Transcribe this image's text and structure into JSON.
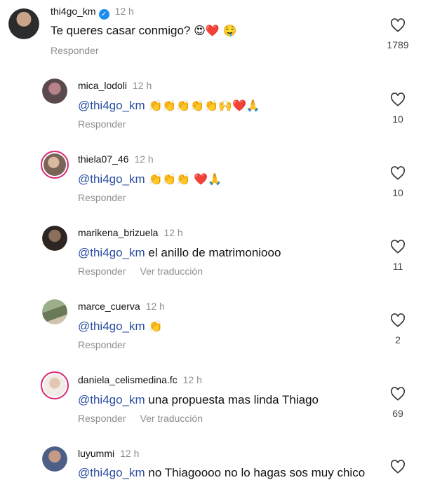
{
  "comments": [
    {
      "username": "thi4go_km",
      "time": "12 h",
      "verified": true,
      "mention": "",
      "text": "Te queres casar conmigo? ",
      "emoji": "😍❤️ 🤤",
      "reply": "Responder",
      "translate": "",
      "likes": "1789"
    },
    {
      "username": "mica_lodoli",
      "time": "12 h",
      "mention": "@thi4go_km",
      "text": "",
      "emoji": "👏👏👏👏👏🙌❤️🙏",
      "reply": "Responder",
      "translate": "",
      "likes": "10"
    },
    {
      "username": "thiela07_46",
      "time": "12 h",
      "mention": "@thi4go_km",
      "text": "",
      "emoji": "👏👏👏 ❤️🙏",
      "reply": "Responder",
      "translate": "",
      "likes": "10"
    },
    {
      "username": "marikena_brizuela",
      "time": "12 h",
      "mention": "@thi4go_km",
      "text": " el anillo de matrimoniooo",
      "emoji": "",
      "reply": "Responder",
      "translate": "Ver traducción",
      "likes": "11"
    },
    {
      "username": "marce_cuerva",
      "time": "12 h",
      "mention": "@thi4go_km",
      "text": "",
      "emoji": "👏",
      "reply": "Responder",
      "translate": "",
      "likes": "2"
    },
    {
      "username": "daniela_celismedina.fc",
      "time": "12 h",
      "mention": "@thi4go_km",
      "text": " una propuesta mas linda Thiago",
      "emoji": "",
      "reply": "Responder",
      "translate": "Ver traducción",
      "likes": "69"
    },
    {
      "username": "luyummi",
      "time": "12 h",
      "mention": "@thi4go_km",
      "text": " no Thiagoooo no lo hagas sos muy chico",
      "emoji": "",
      "reply": "",
      "translate": "",
      "likes": ""
    }
  ],
  "colors": {
    "mention": "#2b4ea2",
    "muted": "#8e8e8e",
    "verified": "#1d8cf0",
    "story_ring": "#d62976"
  },
  "icons": {
    "like": "heart-outline-icon",
    "verified": "verified-badge-icon"
  }
}
